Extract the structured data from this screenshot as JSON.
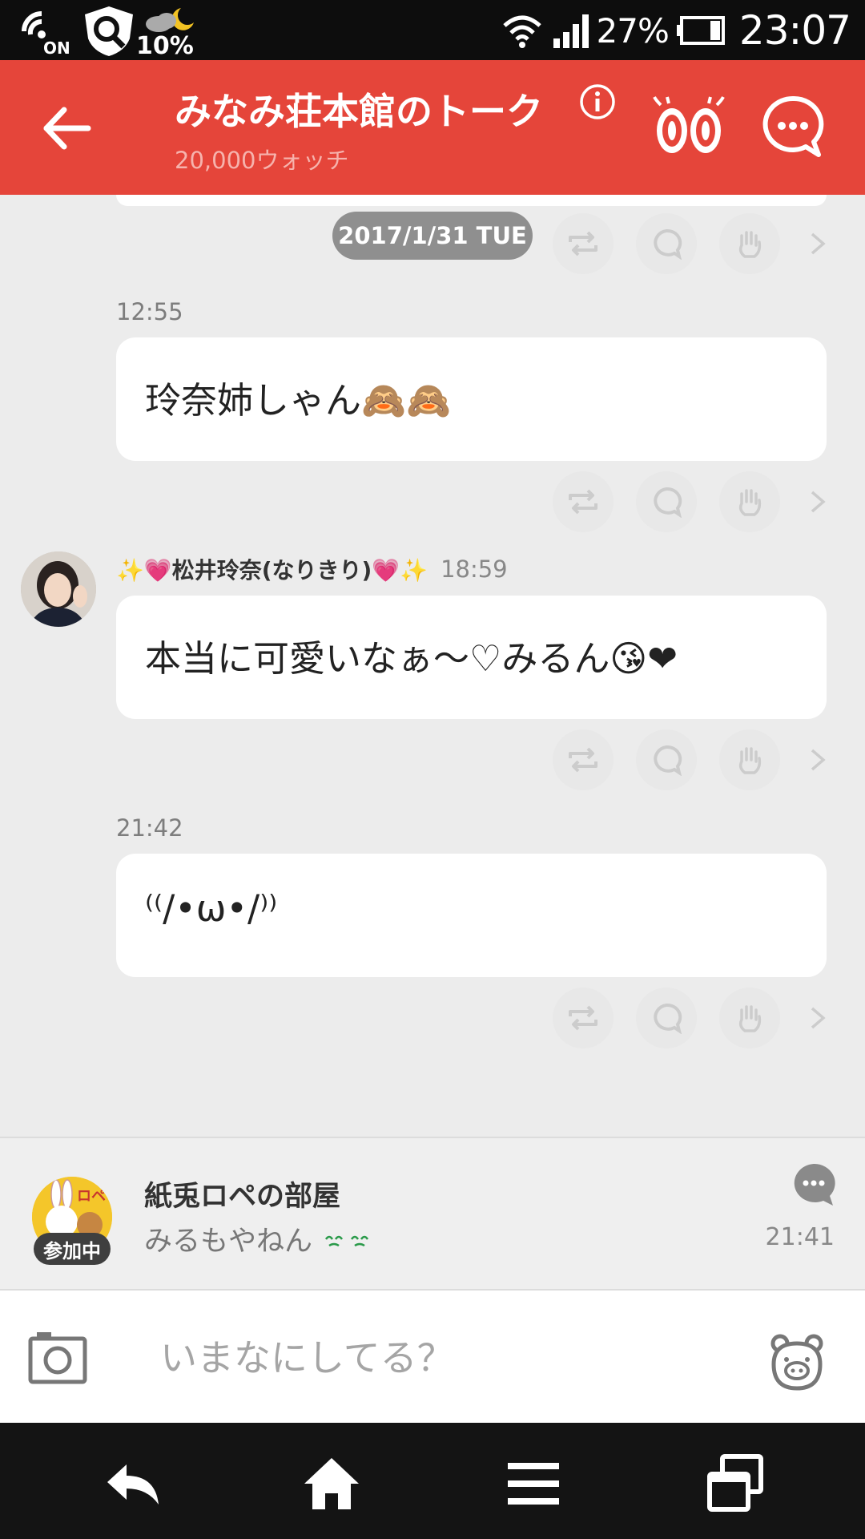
{
  "status_bar": {
    "nfc_label": "ON",
    "weather_percent": "10%",
    "battery_percent": "27%",
    "time": "23:07"
  },
  "header": {
    "title": "みなみ荘本館のトーク",
    "watch_count": "20,000ウォッチ",
    "accent_color": "#e5453a"
  },
  "timeline": {
    "date": "2017/1/31 TUE",
    "messages": [
      {
        "time": "12:55",
        "text": "玲奈姉しゃん🙈🙈"
      },
      {
        "sender": "✨💗松井玲奈(なりきり)💗✨",
        "time": "18:59",
        "text": "本当に可愛いなぁ〜♡みるん😘❤"
      },
      {
        "time": "21:42",
        "text": "⁽⁽/•ω•/⁾⁾"
      }
    ]
  },
  "room_banner": {
    "room_name": "紙兎ロペの部屋",
    "badge": "参加中",
    "last_message": "みるもやねん",
    "time": "21:41",
    "avatar_text": "ロペ"
  },
  "composer": {
    "placeholder": "いまなにしてる？"
  },
  "icons": {
    "back": "arrow-left-icon",
    "info": "info-icon",
    "watch": "eyes-icon",
    "menu": "chat-menu-icon",
    "retalk": "retalk-icon",
    "comment": "comment-icon",
    "clap": "clap-hand-icon",
    "camera": "camera-icon",
    "stamp": "bear-stamp-icon"
  }
}
